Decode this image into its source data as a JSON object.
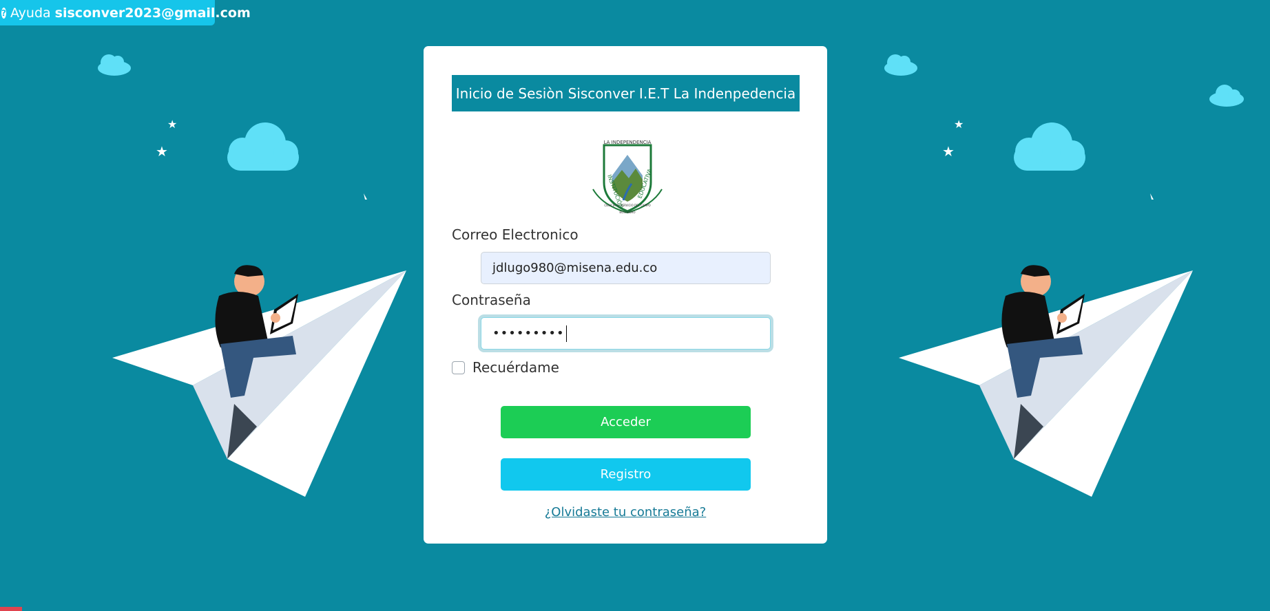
{
  "help": {
    "label": "Ayuda",
    "email": "sisconver2023@gmail.com",
    "icon": "question-circle-icon"
  },
  "login": {
    "title": "Inicio de Sesiòn Sisconver I.E.T La Indenpedencia",
    "logo_text": [
      "LA INDEPENDENCIA",
      "INSTITUCIÓN",
      "EDUCATIVA",
      "CIENCIA AL SERVICIO DEL CAMPO",
      "BOSANDRO"
    ],
    "email_label": "Correo Electronico",
    "email_value": "jdlugo980@misena.edu.co",
    "password_label": "Contraseña",
    "password_value": "•••••••••",
    "remember_label": "Recuérdame",
    "login_button": "Acceder",
    "register_button": "Registro",
    "forgot_link": "¿Olvidaste tu contraseña?"
  },
  "colors": {
    "background": "#0a8aa0",
    "help_bar": "#16c5ea",
    "header": "#0a8aa0",
    "acceder": "#1ccd55",
    "registro": "#11c8ee",
    "link": "#167a96",
    "cloud": "#5fe0f7"
  }
}
